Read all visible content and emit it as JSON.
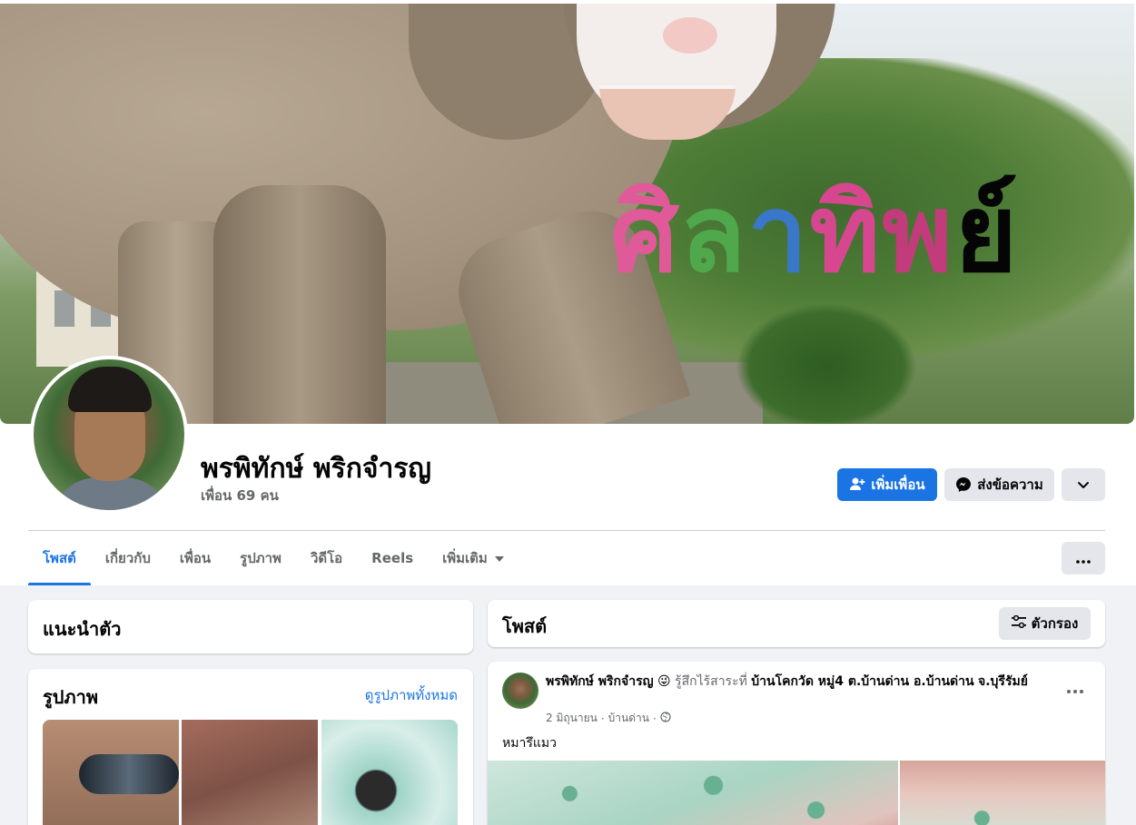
{
  "profile": {
    "name": "พรพิทักษ์ พริกจำรญ",
    "friends": "เพื่อน 69 คน",
    "cover_sign_text": [
      "ศ",
      "ิ",
      "ล",
      "า",
      "ท",
      "ิ",
      "พ",
      "ย",
      "์"
    ]
  },
  "actions": {
    "add_friend": "เพิ่มเพื่อน",
    "message": "ส่งข้อความ"
  },
  "tabs": [
    {
      "label": "โพสต์",
      "active": true
    },
    {
      "label": "เกี่ยวกับ",
      "active": false
    },
    {
      "label": "เพื่อน",
      "active": false
    },
    {
      "label": "รูปภาพ",
      "active": false
    },
    {
      "label": "วิดีโอ",
      "active": false
    },
    {
      "label": "Reels",
      "active": false
    },
    {
      "label": "เพิ่มเติม",
      "active": false
    }
  ],
  "intro": {
    "title": "แนะนำตัว"
  },
  "photos": {
    "title": "รูปภาพ",
    "see_all": "ดูรูปภาพทั้งหมด"
  },
  "posts_section": {
    "title": "โพสต์",
    "filter": "ตัวกรอง"
  },
  "post": {
    "author": "พรพิทักษ์ พริกจำรญ",
    "emoji": "😜",
    "feeling": "รู้สึกไร้สาระที่",
    "location_part1": "บ้านโคกวัด หมู่4 ต.บ้านด่าน อ.บ้านด่าน",
    "location_part2": "จ.บุรีรัมย์",
    "date": "2 มิถุนายน",
    "place": "บ้านด่าน",
    "text": "หมารึแมว"
  },
  "colors": {
    "accent": "#1b74e4",
    "background": "#f0f2f5",
    "secondary_button": "#e4e6eb",
    "muted_text": "#65676b"
  }
}
